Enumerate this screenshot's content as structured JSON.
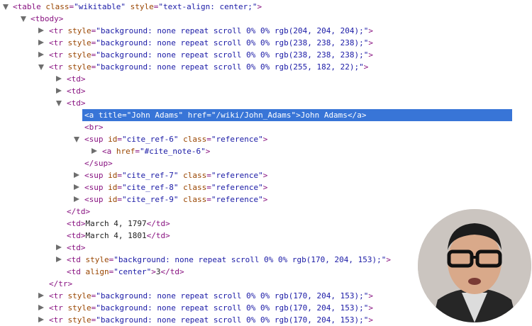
{
  "rows": [
    {
      "tri": "open",
      "open": "table",
      "attrs": [
        {
          "n": "class",
          "v": "wikitable"
        },
        {
          "n": "style",
          "v": "text-align: center;"
        }
      ],
      "close": ""
    },
    {
      "tri": "open",
      "open": "tbody",
      "attrs": [],
      "close": ""
    },
    {
      "tri": "closed",
      "open": "tr",
      "attrs": [
        {
          "n": "style",
          "v": "background: none repeat scroll 0% 0% rgb(204, 204, 204);"
        }
      ],
      "close": ""
    },
    {
      "tri": "closed",
      "open": "tr",
      "attrs": [
        {
          "n": "style",
          "v": "background: none repeat scroll 0% 0% rgb(238, 238, 238);"
        }
      ],
      "close": ""
    },
    {
      "tri": "closed",
      "open": "tr",
      "attrs": [
        {
          "n": "style",
          "v": "background: none repeat scroll 0% 0% rgb(238, 238, 238);"
        }
      ],
      "close": ""
    },
    {
      "tri": "open",
      "open": "tr",
      "attrs": [
        {
          "n": "style",
          "v": "background: none repeat scroll 0% 0% rgb(255, 182, 22);"
        }
      ],
      "close": ""
    },
    {
      "tri": "closed",
      "open": "td",
      "attrs": [],
      "close": ""
    },
    {
      "tri": "closed",
      "open": "td",
      "attrs": [],
      "close": ""
    },
    {
      "tri": "open",
      "open": "td",
      "attrs": [],
      "close": ""
    },
    {
      "tri": "",
      "open": "a",
      "attrs": [
        {
          "n": "title",
          "v": "John Adams"
        },
        {
          "n": "href",
          "v": "/wiki/John_Adams"
        }
      ],
      "text": "John Adams",
      "close": "a",
      "selected": true
    },
    {
      "tri": "",
      "open": "br",
      "attrs": [],
      "close": ""
    },
    {
      "tri": "open",
      "open": "sup",
      "attrs": [
        {
          "n": "id",
          "v": "cite_ref-6"
        },
        {
          "n": "class",
          "v": "reference"
        }
      ],
      "close": ""
    },
    {
      "tri": "closed",
      "open": "a",
      "attrs": [
        {
          "n": "href",
          "v": "#cite_note-6"
        }
      ],
      "close": ""
    },
    {
      "tri": "",
      "closing": "sup"
    },
    {
      "tri": "closed",
      "open": "sup",
      "attrs": [
        {
          "n": "id",
          "v": "cite_ref-7"
        },
        {
          "n": "class",
          "v": "reference"
        }
      ],
      "close": ""
    },
    {
      "tri": "closed",
      "open": "sup",
      "attrs": [
        {
          "n": "id",
          "v": "cite_ref-8"
        },
        {
          "n": "class",
          "v": "reference"
        }
      ],
      "close": ""
    },
    {
      "tri": "closed",
      "open": "sup",
      "attrs": [
        {
          "n": "id",
          "v": "cite_ref-9"
        },
        {
          "n": "class",
          "v": "reference"
        }
      ],
      "close": ""
    },
    {
      "tri": "",
      "closing": "td"
    },
    {
      "tri": "",
      "open": "td",
      "attrs": [],
      "text": "March 4, 1797",
      "close": "td"
    },
    {
      "tri": "",
      "open": "td",
      "attrs": [],
      "text": "March 4, 1801",
      "close": "td"
    },
    {
      "tri": "closed",
      "open": "td",
      "attrs": [],
      "close": ""
    },
    {
      "tri": "closed",
      "open": "td",
      "attrs": [
        {
          "n": "style",
          "v": "background: none repeat scroll 0% 0% rgb(170, 204, 153);"
        }
      ],
      "close": ""
    },
    {
      "tri": "",
      "open": "td",
      "attrs": [
        {
          "n": "align",
          "v": "center"
        }
      ],
      "text": "3",
      "close": "td"
    },
    {
      "tri": "",
      "closing": "tr"
    },
    {
      "tri": "closed",
      "open": "tr",
      "attrs": [
        {
          "n": "style",
          "v": "background: none repeat scroll 0% 0% rgb(170, 204, 153);"
        }
      ],
      "close": ""
    },
    {
      "tri": "closed",
      "open": "tr",
      "attrs": [
        {
          "n": "style",
          "v": "background: none repeat scroll 0% 0% rgb(170, 204, 153);"
        }
      ],
      "close": ""
    },
    {
      "tri": "closed",
      "open": "tr",
      "attrs": [
        {
          "n": "style",
          "v": "background: none repeat scroll 0% 0% rgb(170, 204, 153);"
        }
      ],
      "close": ""
    }
  ],
  "colors": {
    "tag": "#881280",
    "attr_name": "#994500",
    "attr_value": "#1a1aa6",
    "text": "#222222",
    "selection": "#3875d7",
    "triangle": "#6e6e6e"
  },
  "avatar": {
    "icon": "person-avatar-icon"
  }
}
